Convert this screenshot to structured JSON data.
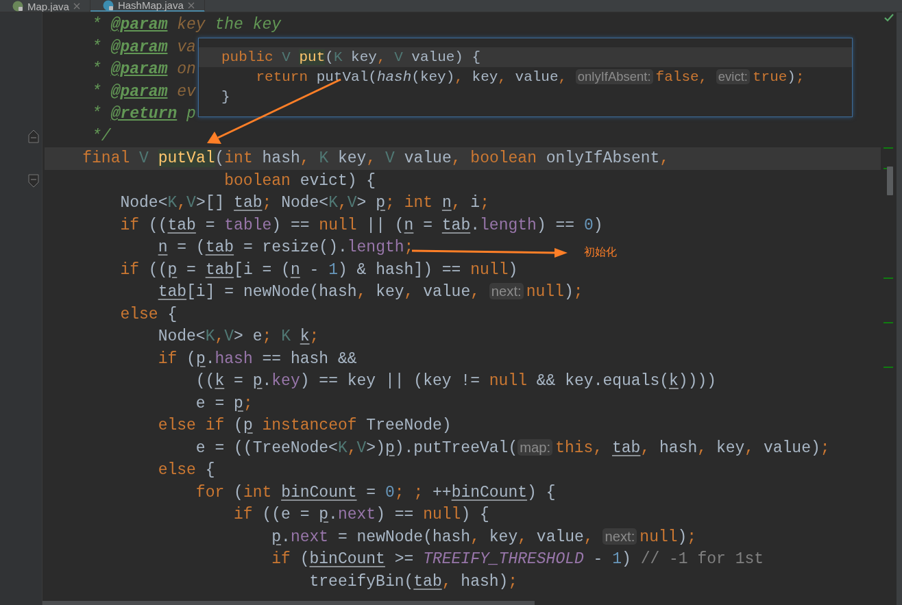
{
  "tabs": [
    {
      "label": "Map.java",
      "kind": "interface",
      "selected": false
    },
    {
      "label": "HashMap.java",
      "kind": "class",
      "selected": true
    }
  ],
  "editor": {
    "lines": [
      {
        "current": false,
        "tokens": [
          {
            "kind": "doc",
            "text": "     * "
          },
          {
            "kind": "doctag",
            "text": "@param"
          },
          {
            "kind": "docparam",
            "text": " key"
          },
          {
            "kind": "doc",
            "text": " the key"
          }
        ]
      },
      {
        "current": false,
        "tokens": [
          {
            "kind": "doc",
            "text": "     * "
          },
          {
            "kind": "doctag",
            "text": "@param"
          },
          {
            "kind": "docparam",
            "text": " va"
          }
        ]
      },
      {
        "current": false,
        "tokens": [
          {
            "kind": "doc",
            "text": "     * "
          },
          {
            "kind": "doctag",
            "text": "@param"
          },
          {
            "kind": "docparam",
            "text": " on"
          }
        ]
      },
      {
        "current": false,
        "tokens": [
          {
            "kind": "doc",
            "text": "     * "
          },
          {
            "kind": "doctag",
            "text": "@param"
          },
          {
            "kind": "docparam",
            "text": " ev"
          }
        ]
      },
      {
        "current": false,
        "tokens": [
          {
            "kind": "doc",
            "text": "     * "
          },
          {
            "kind": "doctag",
            "text": "@return"
          },
          {
            "kind": "doc",
            "text": " p"
          }
        ]
      },
      {
        "current": false,
        "kind": "fold-end",
        "tokens": [
          {
            "kind": "doc",
            "text": "     */"
          }
        ]
      },
      {
        "current": true,
        "tokens": [
          {
            "kind": "kw",
            "text": "    final"
          },
          {
            "kind": "tparam",
            "text": " V"
          },
          {
            "kind": "match",
            "text": " putVal"
          },
          {
            "kind": "plain",
            "text": "("
          },
          {
            "kind": "kw",
            "text": "int"
          },
          {
            "kind": "plain",
            "text": " hash"
          },
          {
            "kind": "kw",
            "text": ","
          },
          {
            "kind": "tparam",
            "text": " K"
          },
          {
            "kind": "plain",
            "text": " key"
          },
          {
            "kind": "kw",
            "text": ","
          },
          {
            "kind": "tparam",
            "text": " V"
          },
          {
            "kind": "plain",
            "text": " value"
          },
          {
            "kind": "kw",
            "text": ","
          },
          {
            "kind": "kw",
            "text": " boolean"
          },
          {
            "kind": "plain",
            "text": " onlyIfAbsent"
          },
          {
            "kind": "kw",
            "text": ","
          }
        ]
      },
      {
        "current": false,
        "kind": "fold-start",
        "tokens": [
          {
            "kind": "kw",
            "text": "                   boolean"
          },
          {
            "kind": "plain",
            "text": " evict) {"
          }
        ]
      },
      {
        "current": false,
        "tokens": [
          {
            "kind": "plain",
            "text": "        Node<"
          },
          {
            "kind": "tparam",
            "text": "K"
          },
          {
            "kind": "kw",
            "text": ","
          },
          {
            "kind": "tparam",
            "text": "V"
          },
          {
            "kind": "plain",
            "text": ">[]"
          },
          {
            "kind": "var",
            "text": " tab"
          },
          {
            "kind": "kw",
            "text": ";"
          },
          {
            "kind": "plain",
            "text": " Node<"
          },
          {
            "kind": "tparam",
            "text": "K"
          },
          {
            "kind": "kw",
            "text": ","
          },
          {
            "kind": "tparam",
            "text": "V"
          },
          {
            "kind": "plain",
            "text": ">"
          },
          {
            "kind": "var",
            "text": " p"
          },
          {
            "kind": "kw",
            "text": ";"
          },
          {
            "kind": "kw",
            "text": " int"
          },
          {
            "kind": "var",
            "text": " n"
          },
          {
            "kind": "kw",
            "text": ","
          },
          {
            "kind": "plain",
            "text": " i"
          },
          {
            "kind": "kw",
            "text": ";"
          }
        ]
      },
      {
        "current": false,
        "tokens": [
          {
            "kind": "kw",
            "text": "        if"
          },
          {
            "kind": "plain",
            "text": " (("
          },
          {
            "kind": "var",
            "text": "tab"
          },
          {
            "kind": "plain",
            "text": " = "
          },
          {
            "kind": "field",
            "text": "table"
          },
          {
            "kind": "plain",
            "text": ") == "
          },
          {
            "kind": "kw",
            "text": "null"
          },
          {
            "kind": "plain",
            "text": " || ("
          },
          {
            "kind": "var",
            "text": "n"
          },
          {
            "kind": "plain",
            "text": " = "
          },
          {
            "kind": "var",
            "text": "tab"
          },
          {
            "kind": "plain",
            "text": "."
          },
          {
            "kind": "field",
            "text": "length"
          },
          {
            "kind": "plain",
            "text": ") == "
          },
          {
            "kind": "num",
            "text": "0"
          },
          {
            "kind": "plain",
            "text": ")"
          }
        ]
      },
      {
        "current": false,
        "tokens": [
          {
            "kind": "var",
            "text": "            n"
          },
          {
            "kind": "plain",
            "text": " = ("
          },
          {
            "kind": "var",
            "text": "tab"
          },
          {
            "kind": "plain",
            "text": " = resize()."
          },
          {
            "kind": "field",
            "text": "length"
          },
          {
            "kind": "kw",
            "text": ";"
          }
        ]
      },
      {
        "current": false,
        "tokens": [
          {
            "kind": "kw",
            "text": "        if"
          },
          {
            "kind": "plain",
            "text": " (("
          },
          {
            "kind": "var",
            "text": "p"
          },
          {
            "kind": "plain",
            "text": " = "
          },
          {
            "kind": "var",
            "text": "tab"
          },
          {
            "kind": "plain",
            "text": "[i = ("
          },
          {
            "kind": "var",
            "text": "n"
          },
          {
            "kind": "plain",
            "text": " - "
          },
          {
            "kind": "num",
            "text": "1"
          },
          {
            "kind": "plain",
            "text": ") & hash]) == "
          },
          {
            "kind": "kw",
            "text": "null"
          },
          {
            "kind": "plain",
            "text": ")"
          }
        ]
      },
      {
        "current": false,
        "tokens": [
          {
            "kind": "var",
            "text": "            tab"
          },
          {
            "kind": "plain",
            "text": "[i] = newNode(hash"
          },
          {
            "kind": "kw",
            "text": ","
          },
          {
            "kind": "plain",
            "text": " key"
          },
          {
            "kind": "kw",
            "text": ","
          },
          {
            "kind": "plain",
            "text": " value"
          },
          {
            "kind": "kw",
            "text": ", "
          },
          {
            "kind": "hint",
            "text": "next:"
          },
          {
            "kind": "kw",
            "text": "null"
          },
          {
            "kind": "plain",
            "text": ")"
          },
          {
            "kind": "kw",
            "text": ";"
          }
        ]
      },
      {
        "current": false,
        "tokens": [
          {
            "kind": "kw",
            "text": "        else"
          },
          {
            "kind": "plain",
            "text": " {"
          }
        ]
      },
      {
        "current": false,
        "tokens": [
          {
            "kind": "plain",
            "text": "            Node<"
          },
          {
            "kind": "tparam",
            "text": "K"
          },
          {
            "kind": "kw",
            "text": ","
          },
          {
            "kind": "tparam",
            "text": "V"
          },
          {
            "kind": "plain",
            "text": "> e"
          },
          {
            "kind": "kw",
            "text": ";"
          },
          {
            "kind": "tparam",
            "text": " K"
          },
          {
            "kind": "var",
            "text": " k"
          },
          {
            "kind": "kw",
            "text": ";"
          }
        ]
      },
      {
        "current": false,
        "tokens": [
          {
            "kind": "kw",
            "text": "            if"
          },
          {
            "kind": "plain",
            "text": " ("
          },
          {
            "kind": "var",
            "text": "p"
          },
          {
            "kind": "plain",
            "text": "."
          },
          {
            "kind": "field",
            "text": "hash"
          },
          {
            "kind": "plain",
            "text": " == hash &&"
          }
        ]
      },
      {
        "current": false,
        "tokens": [
          {
            "kind": "plain",
            "text": "                (("
          },
          {
            "kind": "var",
            "text": "k"
          },
          {
            "kind": "plain",
            "text": " = "
          },
          {
            "kind": "var",
            "text": "p"
          },
          {
            "kind": "plain",
            "text": "."
          },
          {
            "kind": "field",
            "text": "key"
          },
          {
            "kind": "plain",
            "text": ") == key || (key != "
          },
          {
            "kind": "kw",
            "text": "null"
          },
          {
            "kind": "plain",
            "text": " && key.equals("
          },
          {
            "kind": "var",
            "text": "k"
          },
          {
            "kind": "plain",
            "text": "))))"
          }
        ]
      },
      {
        "current": false,
        "tokens": [
          {
            "kind": "plain",
            "text": "                e = "
          },
          {
            "kind": "var",
            "text": "p"
          },
          {
            "kind": "kw",
            "text": ";"
          }
        ]
      },
      {
        "current": false,
        "tokens": [
          {
            "kind": "kw",
            "text": "            else if"
          },
          {
            "kind": "plain",
            "text": " ("
          },
          {
            "kind": "var",
            "text": "p"
          },
          {
            "kind": "kw",
            "text": " instanceof"
          },
          {
            "kind": "plain",
            "text": " TreeNode)"
          }
        ]
      },
      {
        "current": false,
        "tokens": [
          {
            "kind": "plain",
            "text": "                e = ((TreeNode<"
          },
          {
            "kind": "tparam",
            "text": "K"
          },
          {
            "kind": "kw",
            "text": ","
          },
          {
            "kind": "tparam",
            "text": "V"
          },
          {
            "kind": "plain",
            "text": ">)"
          },
          {
            "kind": "var",
            "text": "p"
          },
          {
            "kind": "plain",
            "text": ").putTreeVal("
          },
          {
            "kind": "hint",
            "text": "map:"
          },
          {
            "kind": "kw",
            "text": "this"
          },
          {
            "kind": "kw",
            "text": ","
          },
          {
            "kind": "var",
            "text": " tab"
          },
          {
            "kind": "kw",
            "text": ","
          },
          {
            "kind": "plain",
            "text": " hash"
          },
          {
            "kind": "kw",
            "text": ","
          },
          {
            "kind": "plain",
            "text": " key"
          },
          {
            "kind": "kw",
            "text": ","
          },
          {
            "kind": "plain",
            "text": " value)"
          },
          {
            "kind": "kw",
            "text": ";"
          }
        ]
      },
      {
        "current": false,
        "tokens": [
          {
            "kind": "kw",
            "text": "            else"
          },
          {
            "kind": "plain",
            "text": " {"
          }
        ]
      },
      {
        "current": false,
        "tokens": [
          {
            "kind": "kw",
            "text": "                for"
          },
          {
            "kind": "plain",
            "text": " ("
          },
          {
            "kind": "kw",
            "text": "int"
          },
          {
            "kind": "var",
            "text": " binCount"
          },
          {
            "kind": "plain",
            "text": " = "
          },
          {
            "kind": "num",
            "text": "0"
          },
          {
            "kind": "kw",
            "text": ";"
          },
          {
            "kind": "kw",
            "text": " ;"
          },
          {
            "kind": "plain",
            "text": " ++"
          },
          {
            "kind": "var",
            "text": "binCount"
          },
          {
            "kind": "plain",
            "text": ") {"
          }
        ]
      },
      {
        "current": false,
        "tokens": [
          {
            "kind": "kw",
            "text": "                    if"
          },
          {
            "kind": "plain",
            "text": " ((e = "
          },
          {
            "kind": "var",
            "text": "p"
          },
          {
            "kind": "plain",
            "text": "."
          },
          {
            "kind": "field",
            "text": "next"
          },
          {
            "kind": "plain",
            "text": ") == "
          },
          {
            "kind": "kw",
            "text": "null"
          },
          {
            "kind": "plain",
            "text": ") {"
          }
        ]
      },
      {
        "current": false,
        "tokens": [
          {
            "kind": "var",
            "text": "                        p"
          },
          {
            "kind": "plain",
            "text": "."
          },
          {
            "kind": "field",
            "text": "next"
          },
          {
            "kind": "plain",
            "text": " = newNode(hash"
          },
          {
            "kind": "kw",
            "text": ","
          },
          {
            "kind": "plain",
            "text": " key"
          },
          {
            "kind": "kw",
            "text": ","
          },
          {
            "kind": "plain",
            "text": " value"
          },
          {
            "kind": "kw",
            "text": ", "
          },
          {
            "kind": "hint",
            "text": "next:"
          },
          {
            "kind": "kw",
            "text": "null"
          },
          {
            "kind": "plain",
            "text": ")"
          },
          {
            "kind": "kw",
            "text": ";"
          }
        ]
      },
      {
        "current": false,
        "tokens": [
          {
            "kind": "kw",
            "text": "                        if"
          },
          {
            "kind": "plain",
            "text": " ("
          },
          {
            "kind": "var",
            "text": "binCount"
          },
          {
            "kind": "plain",
            "text": " >= "
          },
          {
            "kind": "const",
            "text": "TREEIFY_THRESHOLD"
          },
          {
            "kind": "plain",
            "text": " - "
          },
          {
            "kind": "num",
            "text": "1"
          },
          {
            "kind": "plain",
            "text": ")"
          },
          {
            "kind": "comment",
            "text": " // -1 for 1st"
          }
        ]
      },
      {
        "current": false,
        "tokens": [
          {
            "kind": "plain",
            "text": "                            treeifyBin("
          },
          {
            "kind": "var",
            "text": "tab"
          },
          {
            "kind": "kw",
            "text": ","
          },
          {
            "kind": "plain",
            "text": " hash)"
          },
          {
            "kind": "kw",
            "text": ";"
          }
        ]
      }
    ],
    "popup": {
      "lines": [
        {
          "current": true,
          "tokens": [
            {
              "kind": "kw",
              "text": "public"
            },
            {
              "kind": "tparam",
              "text": " V"
            },
            {
              "kind": "match",
              "text": " put"
            },
            {
              "kind": "plain",
              "text": "("
            },
            {
              "kind": "tparam",
              "text": "K"
            },
            {
              "kind": "plain",
              "text": " key"
            },
            {
              "kind": "kw",
              "text": ","
            },
            {
              "kind": "tparam",
              "text": " V"
            },
            {
              "kind": "plain",
              "text": " value) {"
            }
          ]
        },
        {
          "current": false,
          "tokens": [
            {
              "kind": "kw",
              "text": "    return"
            },
            {
              "kind": "plain",
              "text": " putVal("
            },
            {
              "kind": "static",
              "text": "hash"
            },
            {
              "kind": "plain",
              "text": "(key)"
            },
            {
              "kind": "kw",
              "text": ","
            },
            {
              "kind": "plain",
              "text": " key"
            },
            {
              "kind": "kw",
              "text": ","
            },
            {
              "kind": "plain",
              "text": " value"
            },
            {
              "kind": "kw",
              "text": ", "
            },
            {
              "kind": "hint",
              "text": "onlyIfAbsent:"
            },
            {
              "kind": "kw",
              "text": "false"
            },
            {
              "kind": "kw",
              "text": ", "
            },
            {
              "kind": "hint",
              "text": "evict:"
            },
            {
              "kind": "kw",
              "text": "true"
            },
            {
              "kind": "plain",
              "text": ")"
            },
            {
              "kind": "kw",
              "text": ";"
            }
          ]
        },
        {
          "current": false,
          "tokens": [
            {
              "kind": "plain",
              "text": "}"
            }
          ]
        }
      ]
    },
    "annotation": {
      "text": "初始化"
    }
  }
}
